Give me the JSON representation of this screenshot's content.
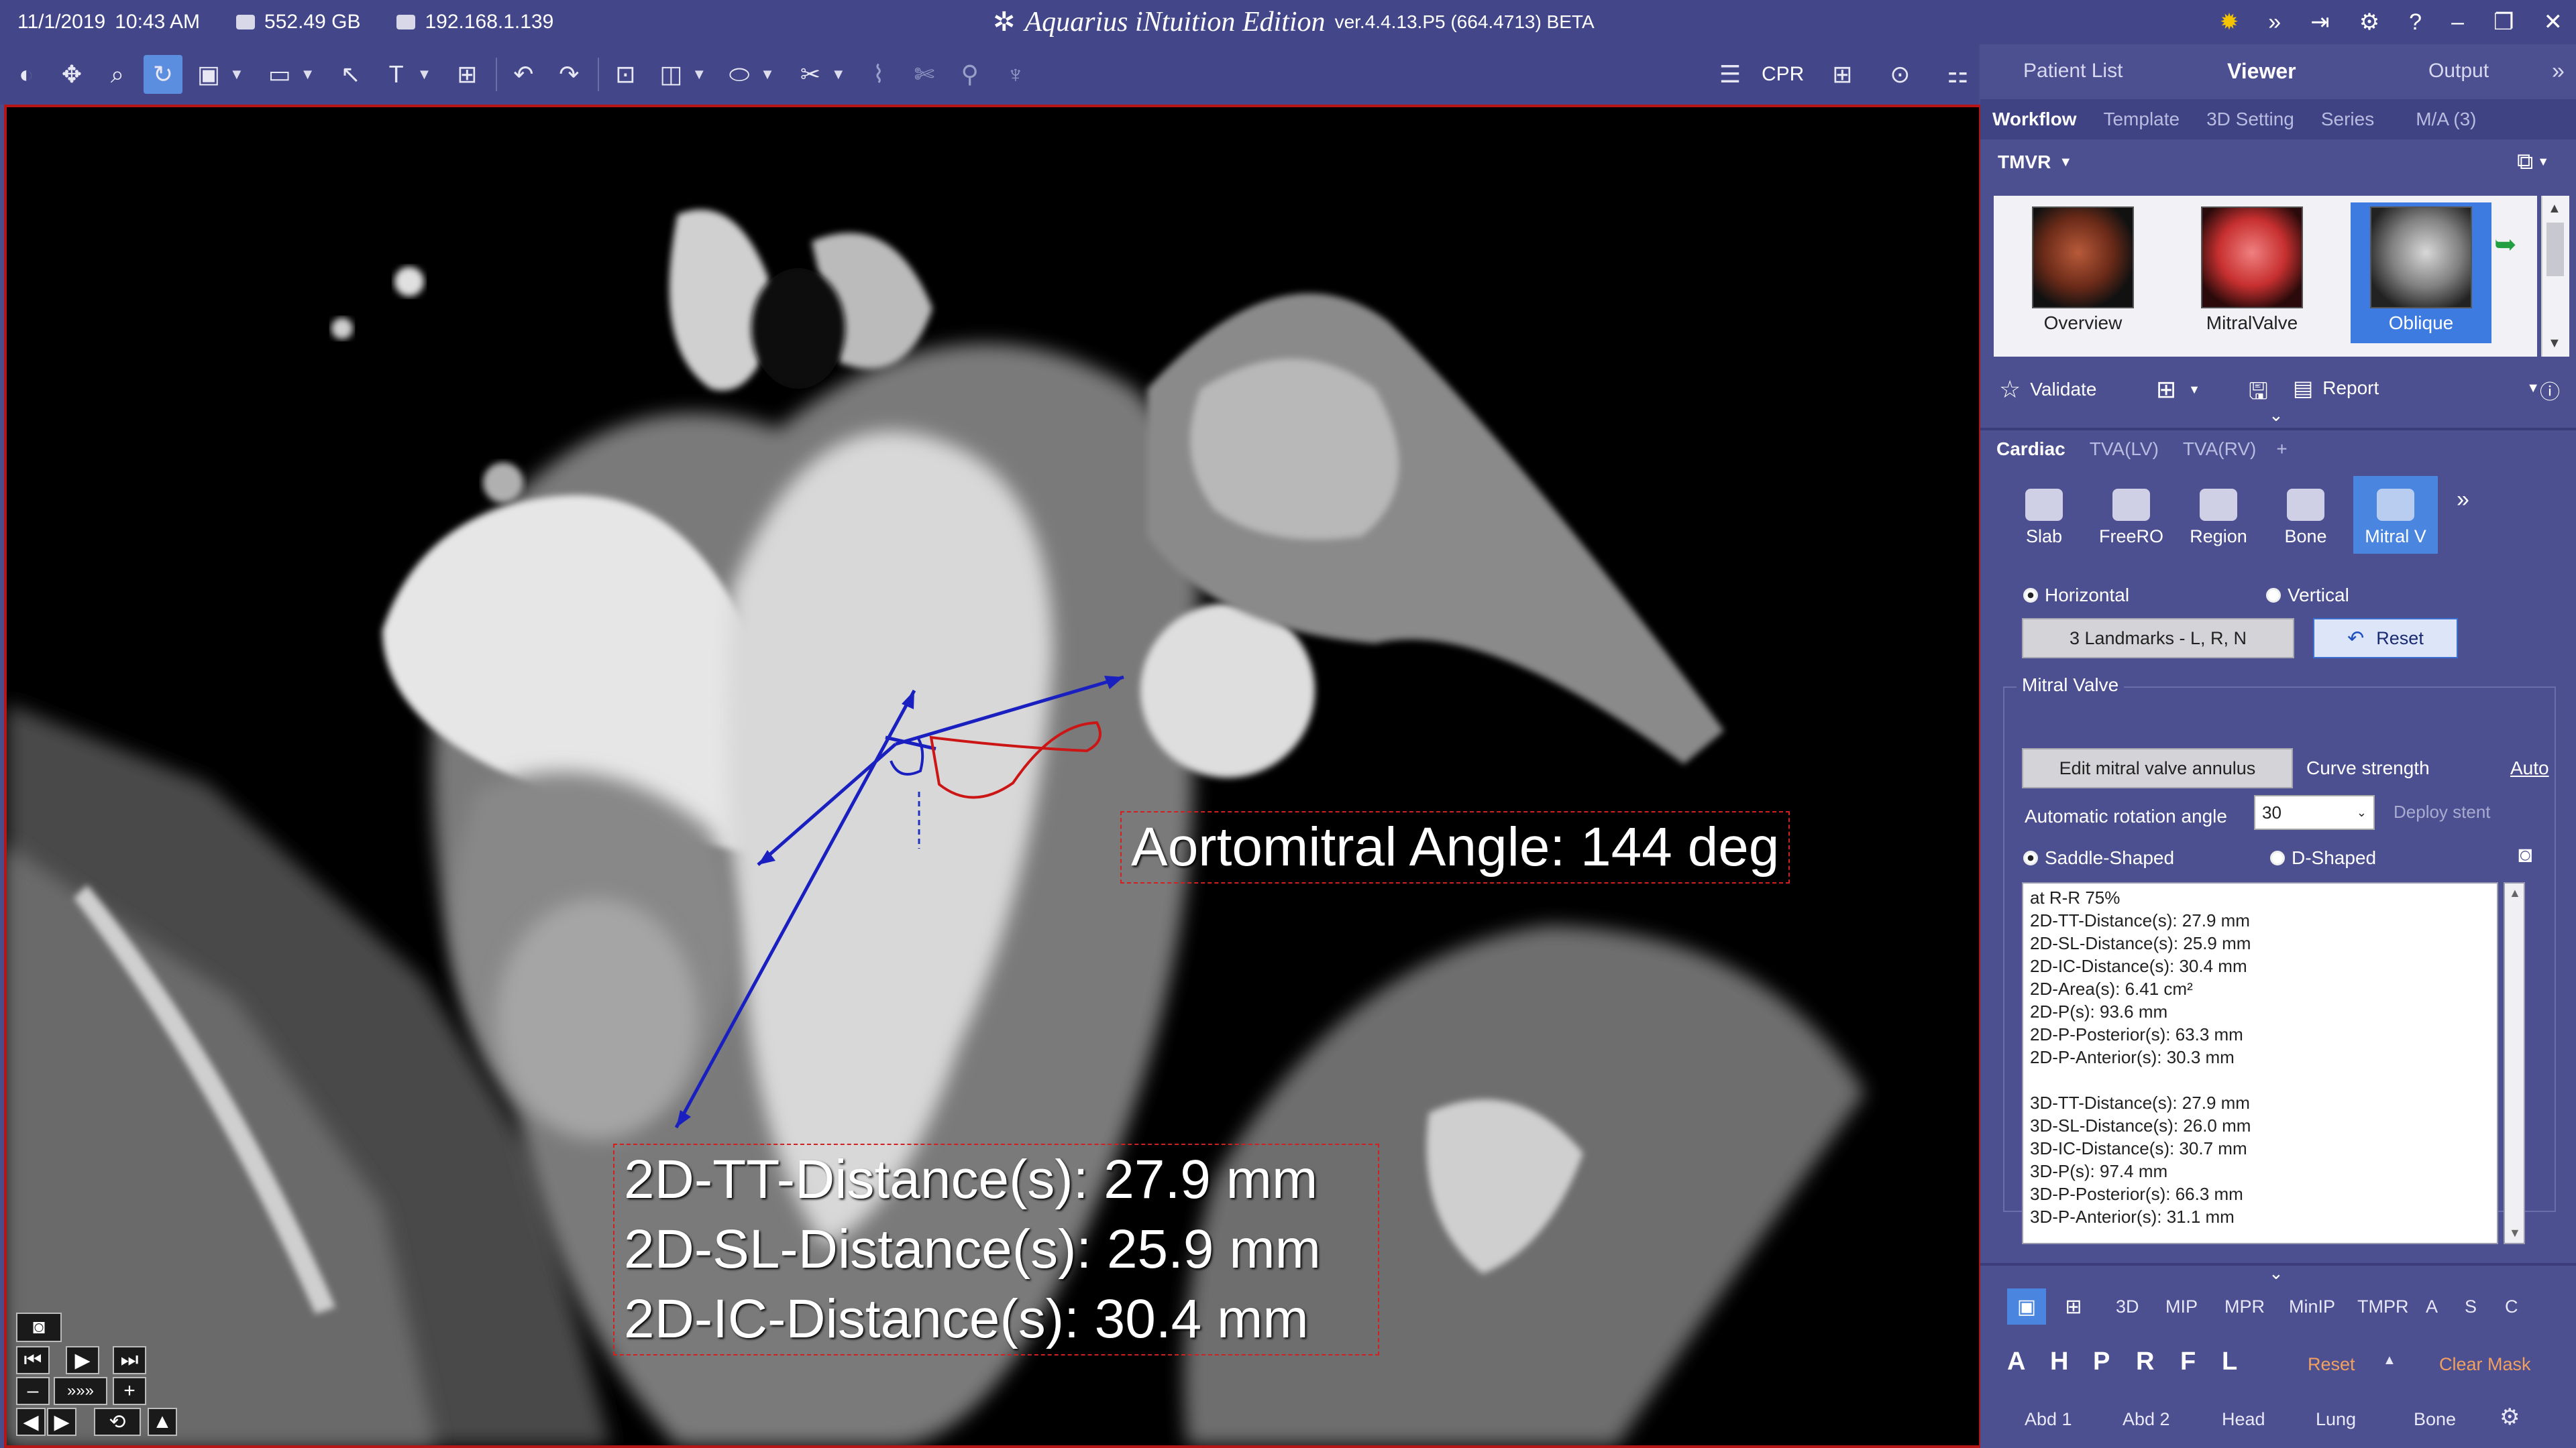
{
  "titlebar": {
    "date": "11/1/2019",
    "time": "10:43 AM",
    "disk": "552.49 GB",
    "ip": "192.168.1.139",
    "brand": "Aquarius iNtuition Edition",
    "version": "ver.4.4.13.P5 (664.4713) BETA"
  },
  "toolbar": {
    "cpr_label": "CPR",
    "icons": [
      "contrast-icon",
      "pan-icon",
      "zoom-icon",
      "rotate-icon",
      "window-level-icon",
      "ruler-icon",
      "pointer-icon",
      "text-icon",
      "grid-icon",
      "undo-icon",
      "redo-icon",
      "overlay-icon",
      "roi-icon",
      "ellipse-icon",
      "segment-icon",
      "sculpt-icon",
      "scissor-icon",
      "probe-icon",
      "vessel-icon"
    ]
  },
  "viewer": {
    "angle_label": "Aortomitral Angle: 144 deg",
    "distances": [
      "2D-TT-Distance(s): 27.9 mm",
      "2D-SL-Distance(s): 25.9 mm",
      "2D-IC-Distance(s): 30.4 mm"
    ]
  },
  "panel": {
    "top_tabs": [
      "Patient List",
      "Viewer",
      "Output"
    ],
    "sub_tabs": [
      "Workflow",
      "Template",
      "3D Setting",
      "Series",
      "M/A (3)"
    ],
    "workflow_name": "TMVR",
    "thumbs": [
      "Overview",
      "MitralValve",
      "Oblique"
    ],
    "validate_label": "Validate",
    "report_label": "Report",
    "cardiac_tabs": [
      "Cardiac",
      "TVA(LV)",
      "TVA(RV)",
      "+"
    ],
    "tools": [
      "Slab",
      "FreeRO",
      "Region",
      "Bone",
      "Mitral V"
    ],
    "orientation": {
      "horizontal": "Horizontal",
      "vertical": "Vertical"
    },
    "landmarks_label": "3 Landmarks - L, R, N",
    "reset_label": "Reset",
    "mitral_group": "Mitral Valve",
    "edit_annulus_label": "Edit mitral valve annulus",
    "curve_strength_label": "Curve strength",
    "auto_label": "Auto",
    "rotation_label": "Automatic rotation angle",
    "rotation_value": "30",
    "deploy_label": "Deploy stent",
    "saddle_label": "Saddle-Shaped",
    "dshaped_label": "D-Shaped",
    "results": [
      "at R-R 75%",
      "2D-TT-Distance(s): 27.9 mm",
      "2D-SL-Distance(s): 25.9 mm",
      "2D-IC-Distance(s): 30.4 mm",
      "2D-Area(s): 6.41 cm²",
      "2D-P(s): 93.6 mm",
      "2D-P-Posterior(s): 63.3 mm",
      "2D-P-Anterior(s): 30.3 mm",
      "",
      "3D-TT-Distance(s): 27.9 mm",
      "3D-SL-Distance(s): 26.0 mm",
      "3D-IC-Distance(s): 30.7 mm",
      "3D-P(s): 97.4 mm",
      "3D-P-Posterior(s): 66.3 mm",
      "3D-P-Anterior(s): 31.1 mm"
    ],
    "render_modes": [
      "3D",
      "MIP",
      "MPR",
      "MinIP",
      "TMPR",
      "A",
      "S",
      "C"
    ],
    "orient_letters": [
      "A",
      "H",
      "P",
      "R",
      "F",
      "L"
    ],
    "reset2_label": "Reset",
    "clear_mask_label": "Clear Mask",
    "presets": [
      "Abd 1",
      "Abd 2",
      "Head",
      "Lung",
      "Bone"
    ]
  }
}
